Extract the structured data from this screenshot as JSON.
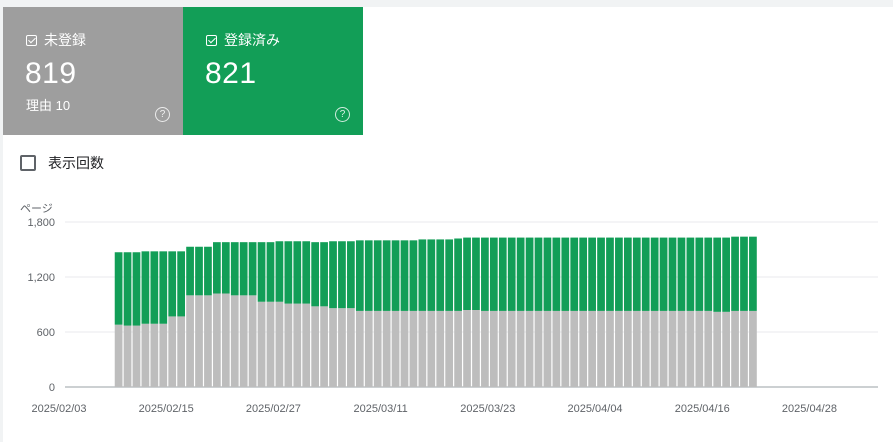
{
  "tiles": [
    {
      "label": "未登録",
      "value": "819",
      "sub": "理由 10",
      "color": "#9e9e9e"
    },
    {
      "label": "登録済み",
      "value": "821",
      "sub": "",
      "color": "#129e57"
    }
  ],
  "impressions_label": "表示回数",
  "help_glyph": "?",
  "chart_data": {
    "type": "bar",
    "stacked": true,
    "ylabel": "ページ",
    "ylim": [
      0,
      1800
    ],
    "y_ticks": [
      "0",
      "600",
      "1,200",
      "1,800"
    ],
    "x_tick_labels": [
      "2025/02/03",
      "2025/02/15",
      "2025/02/27",
      "2025/03/11",
      "2025/03/23",
      "2025/04/04",
      "2025/04/16",
      "2025/04/28"
    ],
    "x_start": "2025/02/03",
    "x_end": "2025/05/05",
    "first_bar": "2025/02/09",
    "series": [
      {
        "name": "未登録",
        "color": "#bdbdbd",
        "values": [
          680,
          670,
          670,
          690,
          690,
          690,
          770,
          770,
          1000,
          1000,
          1000,
          1020,
          1020,
          1000,
          1000,
          1000,
          930,
          930,
          930,
          910,
          910,
          910,
          880,
          880,
          860,
          860,
          860,
          830,
          830,
          830,
          830,
          830,
          830,
          830,
          830,
          830,
          830,
          830,
          830,
          840,
          840,
          830,
          830,
          830,
          830,
          830,
          830,
          830,
          830,
          830,
          830,
          830,
          830,
          830,
          830,
          830,
          830,
          830,
          830,
          830,
          830,
          830,
          830,
          830,
          830,
          830,
          830,
          820,
          820,
          830,
          830,
          830
        ]
      },
      {
        "name": "登録済み",
        "color": "#129e57",
        "values": [
          790,
          800,
          800,
          790,
          790,
          790,
          710,
          710,
          530,
          530,
          530,
          560,
          560,
          580,
          580,
          580,
          650,
          650,
          660,
          680,
          680,
          680,
          700,
          700,
          730,
          730,
          730,
          770,
          770,
          770,
          770,
          770,
          770,
          770,
          780,
          780,
          780,
          780,
          790,
          790,
          790,
          800,
          800,
          800,
          800,
          800,
          800,
          800,
          800,
          800,
          800,
          800,
          800,
          800,
          800,
          800,
          800,
          800,
          800,
          800,
          800,
          800,
          800,
          800,
          800,
          800,
          800,
          810,
          810,
          810,
          810,
          810
        ]
      }
    ]
  }
}
